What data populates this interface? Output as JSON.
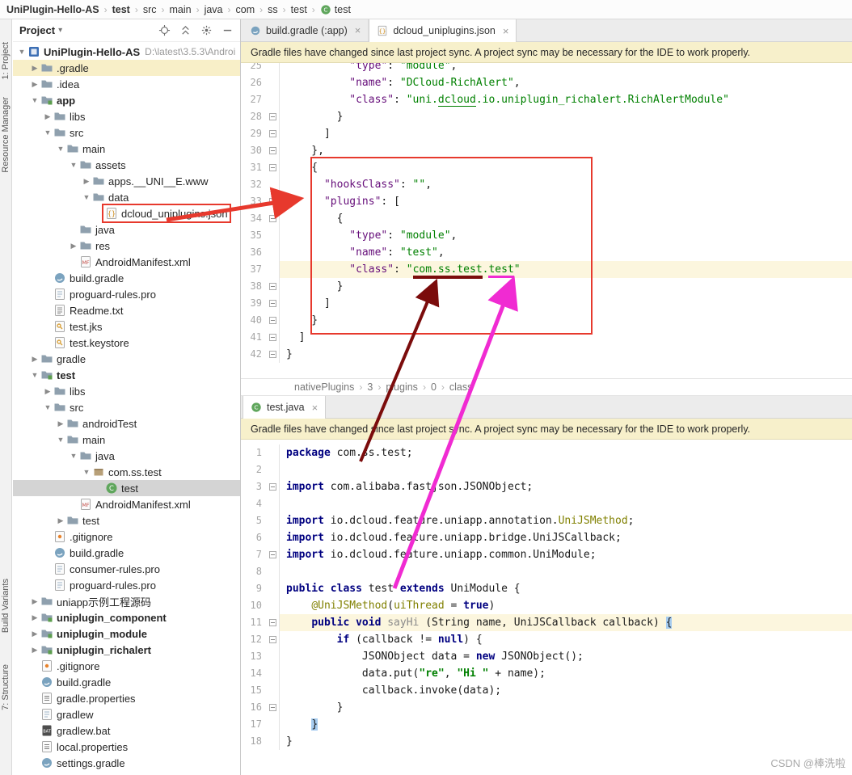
{
  "top_breadcrumb": {
    "items": [
      {
        "label": "UniPlugin-Hello-AS",
        "bold": true
      },
      {
        "label": "test",
        "bold": true
      },
      {
        "label": "src"
      },
      {
        "label": "main"
      },
      {
        "label": "java"
      },
      {
        "label": "com"
      },
      {
        "label": "ss"
      },
      {
        "label": "test"
      },
      {
        "label": "test",
        "icon": "class-icon"
      }
    ]
  },
  "tool_strip": {
    "top": [
      "1: Project",
      "Resource Manager"
    ],
    "bottom": [
      "Build Variants",
      "7: Structure"
    ]
  },
  "project_panel": {
    "title": "Project",
    "tree": [
      {
        "label": "UniPlugin-Hello-AS",
        "suffix": "D:\\latest\\3.5.3\\Androi",
        "level": 0,
        "arrow": "exp",
        "icon": "project-icon",
        "bold": true
      },
      {
        "label": ".gradle",
        "level": 1,
        "arrow": "col",
        "icon": "folder-icon",
        "row": "highlight"
      },
      {
        "label": ".idea",
        "level": 1,
        "arrow": "col",
        "icon": "folder-icon"
      },
      {
        "label": "app",
        "level": 1,
        "arrow": "exp",
        "icon": "module-icon",
        "bold": true
      },
      {
        "label": "libs",
        "level": 2,
        "arrow": "col",
        "icon": "folder-icon"
      },
      {
        "label": "src",
        "level": 2,
        "arrow": "exp",
        "icon": "folder-icon"
      },
      {
        "label": "main",
        "level": 3,
        "arrow": "exp",
        "icon": "folder-icon"
      },
      {
        "label": "assets",
        "level": 4,
        "arrow": "exp",
        "icon": "folder-icon"
      },
      {
        "label": "apps.__UNI__E.www",
        "level": 5,
        "arrow": "col",
        "icon": "folder-icon"
      },
      {
        "label": "data",
        "level": 5,
        "arrow": "exp",
        "icon": "folder-icon"
      },
      {
        "label": "dcloud_uniplugins.json",
        "level": 6,
        "arrow": "none",
        "icon": "json-icon",
        "boxed": true
      },
      {
        "label": "java",
        "level": 4,
        "arrow": "none",
        "icon": "folder-icon"
      },
      {
        "label": "res",
        "level": 4,
        "arrow": "col",
        "icon": "folder-icon"
      },
      {
        "label": "AndroidManifest.xml",
        "level": 4,
        "arrow": "none",
        "icon": "manifest-icon"
      },
      {
        "label": "build.gradle",
        "level": 2,
        "arrow": "none",
        "icon": "gradle-icon"
      },
      {
        "label": "proguard-rules.pro",
        "level": 2,
        "arrow": "none",
        "icon": "file-icon"
      },
      {
        "label": "Readme.txt",
        "level": 2,
        "arrow": "none",
        "icon": "text-icon"
      },
      {
        "label": "test.jks",
        "level": 2,
        "arrow": "none",
        "icon": "key-icon"
      },
      {
        "label": "test.keystore",
        "level": 2,
        "arrow": "none",
        "icon": "key-icon"
      },
      {
        "label": "gradle",
        "level": 1,
        "arrow": "col",
        "icon": "folder-icon"
      },
      {
        "label": "test",
        "level": 1,
        "arrow": "exp",
        "icon": "module-icon",
        "bold": true
      },
      {
        "label": "libs",
        "level": 2,
        "arrow": "col",
        "icon": "folder-icon"
      },
      {
        "label": "src",
        "level": 2,
        "arrow": "exp",
        "icon": "folder-icon"
      },
      {
        "label": "androidTest",
        "level": 3,
        "arrow": "col",
        "icon": "folder-icon"
      },
      {
        "label": "main",
        "level": 3,
        "arrow": "exp",
        "icon": "folder-icon"
      },
      {
        "label": "java",
        "level": 4,
        "arrow": "exp",
        "icon": "folder-icon"
      },
      {
        "label": "com.ss.test",
        "level": 5,
        "arrow": "exp",
        "icon": "package-icon"
      },
      {
        "label": "test",
        "level": 6,
        "arrow": "none",
        "icon": "class-icon",
        "row": "selected"
      },
      {
        "label": "AndroidManifest.xml",
        "level": 4,
        "arrow": "none",
        "icon": "manifest-icon"
      },
      {
        "label": "test",
        "level": 3,
        "arrow": "col",
        "icon": "folder-icon"
      },
      {
        "label": ".gitignore",
        "level": 2,
        "arrow": "none",
        "icon": "git-icon"
      },
      {
        "label": "build.gradle",
        "level": 2,
        "arrow": "none",
        "icon": "gradle-icon"
      },
      {
        "label": "consumer-rules.pro",
        "level": 2,
        "arrow": "none",
        "icon": "file-icon"
      },
      {
        "label": "proguard-rules.pro",
        "level": 2,
        "arrow": "none",
        "icon": "file-icon"
      },
      {
        "label": "uniapp示例工程源码",
        "level": 1,
        "arrow": "col",
        "icon": "folder-icon"
      },
      {
        "label": "uniplugin_component",
        "level": 1,
        "arrow": "col",
        "icon": "module-icon",
        "bold": true
      },
      {
        "label": "uniplugin_module",
        "level": 1,
        "arrow": "col",
        "icon": "module-icon",
        "bold": true
      },
      {
        "label": "uniplugin_richalert",
        "level": 1,
        "arrow": "col",
        "icon": "module-icon",
        "bold": true
      },
      {
        "label": ".gitignore",
        "level": 1,
        "arrow": "none",
        "icon": "git-icon"
      },
      {
        "label": "build.gradle",
        "level": 1,
        "arrow": "none",
        "icon": "gradle-icon"
      },
      {
        "label": "gradle.properties",
        "level": 1,
        "arrow": "none",
        "icon": "props-icon"
      },
      {
        "label": "gradlew",
        "level": 1,
        "arrow": "none",
        "icon": "file-icon"
      },
      {
        "label": "gradlew.bat",
        "level": 1,
        "arrow": "none",
        "icon": "bat-icon"
      },
      {
        "label": "local.properties",
        "level": 1,
        "arrow": "none",
        "icon": "props-icon"
      },
      {
        "label": "settings.gradle",
        "level": 1,
        "arrow": "none",
        "icon": "gradle-icon"
      }
    ]
  },
  "editor_top": {
    "tabs": [
      {
        "label": "build.gradle (:app)",
        "icon": "gradle-icon",
        "active": false
      },
      {
        "label": "dcloud_uniplugins.json",
        "icon": "json-icon",
        "active": true
      }
    ],
    "banner": "Gradle files have changed since last project sync. A project sync may be necessary for the IDE to work properly.",
    "language": "json",
    "lines": [
      {
        "n": 25,
        "seg": [
          [
            "t",
            "          "
          ],
          [
            "k",
            "\"type\""
          ],
          [
            "t",
            ": "
          ],
          [
            "s",
            "\"module\""
          ],
          [
            "t",
            ","
          ]
        ]
      },
      {
        "n": 26,
        "seg": [
          [
            "t",
            "          "
          ],
          [
            "k",
            "\"name\""
          ],
          [
            "t",
            ": "
          ],
          [
            "s",
            "\"DCloud-RichAlert\""
          ],
          [
            "t",
            ","
          ]
        ]
      },
      {
        "n": 27,
        "seg": [
          [
            "t",
            "          "
          ],
          [
            "k",
            "\"class\""
          ],
          [
            "t",
            ": "
          ],
          [
            "s",
            "\"uni."
          ],
          [
            "su",
            "dcloud"
          ],
          [
            "s",
            ".io.uniplugin_richalert.RichAlertModule\""
          ]
        ]
      },
      {
        "n": 28,
        "fold": true,
        "seg": [
          [
            "t",
            "        }"
          ]
        ]
      },
      {
        "n": 29,
        "fold": true,
        "seg": [
          [
            "t",
            "      ]"
          ]
        ]
      },
      {
        "n": 30,
        "fold": true,
        "seg": [
          [
            "t",
            "    },"
          ]
        ]
      },
      {
        "n": 31,
        "fold": true,
        "seg": [
          [
            "t",
            "    {"
          ]
        ]
      },
      {
        "n": 32,
        "seg": [
          [
            "t",
            "      "
          ],
          [
            "k",
            "\"hooksClass\""
          ],
          [
            "t",
            ": "
          ],
          [
            "s",
            "\"\""
          ],
          [
            "t",
            ","
          ]
        ]
      },
      {
        "n": 33,
        "fold": true,
        "seg": [
          [
            "t",
            "      "
          ],
          [
            "k",
            "\"plugins\""
          ],
          [
            "t",
            ": ["
          ]
        ]
      },
      {
        "n": 34,
        "fold": true,
        "seg": [
          [
            "t",
            "        {"
          ]
        ]
      },
      {
        "n": 35,
        "seg": [
          [
            "t",
            "          "
          ],
          [
            "k",
            "\"type\""
          ],
          [
            "t",
            ": "
          ],
          [
            "s",
            "\"module\""
          ],
          [
            "t",
            ","
          ]
        ]
      },
      {
        "n": 36,
        "seg": [
          [
            "t",
            "          "
          ],
          [
            "k",
            "\"name\""
          ],
          [
            "t",
            ": "
          ],
          [
            "s",
            "\"test\""
          ],
          [
            "t",
            ","
          ]
        ]
      },
      {
        "n": 37,
        "hl": true,
        "seg": [
          [
            "t",
            "          "
          ],
          [
            "k",
            "\"class\""
          ],
          [
            "t",
            ": "
          ],
          [
            "s",
            "\""
          ],
          [
            "sr",
            "com.ss.test"
          ],
          [
            "s",
            "."
          ],
          [
            "sm",
            "test"
          ],
          [
            "s",
            "\""
          ]
        ]
      },
      {
        "n": 38,
        "fold": true,
        "seg": [
          [
            "t",
            "        }"
          ]
        ]
      },
      {
        "n": 39,
        "fold": true,
        "seg": [
          [
            "t",
            "      ]"
          ]
        ]
      },
      {
        "n": 40,
        "fold": true,
        "seg": [
          [
            "t",
            "    }"
          ]
        ]
      },
      {
        "n": 41,
        "fold": true,
        "seg": [
          [
            "t",
            "  ]"
          ]
        ]
      },
      {
        "n": 42,
        "fold": true,
        "seg": [
          [
            "t",
            "}"
          ]
        ]
      }
    ]
  },
  "editor_breadcrumb": {
    "items": [
      "nativePlugins",
      "3",
      "plugins",
      "0",
      "class"
    ]
  },
  "editor_bottom": {
    "tabs": [
      {
        "label": "test.java",
        "icon": "class-icon",
        "active": true
      }
    ],
    "banner": "Gradle files have changed since last project sync. A project sync may be necessary for the IDE to work properly.",
    "language": "java",
    "lines": [
      {
        "n": 1,
        "seg": [
          [
            "w",
            "package"
          ],
          [
            "t",
            " com.ss.test;"
          ]
        ]
      },
      {
        "n": 2,
        "seg": []
      },
      {
        "n": 3,
        "fold": true,
        "seg": [
          [
            "w",
            "import"
          ],
          [
            "t",
            " com.alibaba.fastjson.JSONObject;"
          ]
        ]
      },
      {
        "n": 4,
        "seg": []
      },
      {
        "n": 5,
        "seg": [
          [
            "w",
            "import"
          ],
          [
            "t",
            " io.dcloud.feature.uniapp.annotation."
          ],
          [
            "a",
            "UniJSMethod"
          ],
          [
            "t",
            ";"
          ]
        ]
      },
      {
        "n": 6,
        "seg": [
          [
            "w",
            "import"
          ],
          [
            "t",
            " io.dcloud.feature.uniapp.bridge.UniJSCallback;"
          ]
        ]
      },
      {
        "n": 7,
        "fold": true,
        "seg": [
          [
            "w",
            "import"
          ],
          [
            "t",
            " io.dcloud.feature.uniapp.common.UniModule;"
          ]
        ]
      },
      {
        "n": 8,
        "seg": []
      },
      {
        "n": 9,
        "seg": [
          [
            "w",
            "public class"
          ],
          [
            "t",
            " test "
          ],
          [
            "w",
            "extends"
          ],
          [
            "t",
            " UniModule {"
          ]
        ]
      },
      {
        "n": 10,
        "seg": [
          [
            "t",
            "    "
          ],
          [
            "a",
            "@UniJSMethod"
          ],
          [
            "t",
            "("
          ],
          [
            "a",
            "uiThread"
          ],
          [
            "t",
            " = "
          ],
          [
            "w",
            "true"
          ],
          [
            "t",
            ")"
          ]
        ]
      },
      {
        "n": 11,
        "hl": true,
        "fold": true,
        "seg": [
          [
            "t",
            "    "
          ],
          [
            "w",
            "public void"
          ],
          [
            "t",
            " "
          ],
          [
            "g",
            "sayHi"
          ],
          [
            "t",
            " (String name, UniJSCallback callback) "
          ],
          [
            "b",
            "{"
          ]
        ]
      },
      {
        "n": 12,
        "fold": true,
        "seg": [
          [
            "t",
            "        "
          ],
          [
            "w",
            "if"
          ],
          [
            "t",
            " (callback != "
          ],
          [
            "w",
            "null"
          ],
          [
            "t",
            ") {"
          ]
        ]
      },
      {
        "n": 13,
        "seg": [
          [
            "t",
            "            JSONObject data = "
          ],
          [
            "w",
            "new"
          ],
          [
            "t",
            " JSONObject();"
          ]
        ]
      },
      {
        "n": 14,
        "seg": [
          [
            "t",
            "            data.put("
          ],
          [
            "s",
            "\"re\""
          ],
          [
            "t",
            ", "
          ],
          [
            "s",
            "\"Hi \""
          ],
          [
            "t",
            " + name);"
          ]
        ]
      },
      {
        "n": 15,
        "seg": [
          [
            "t",
            "            callback.invoke(data);"
          ]
        ]
      },
      {
        "n": 16,
        "fold": true,
        "seg": [
          [
            "t",
            "        }"
          ]
        ]
      },
      {
        "n": 17,
        "seg": [
          [
            "t",
            "    "
          ],
          [
            "b",
            "}"
          ]
        ]
      },
      {
        "n": 18,
        "seg": [
          [
            "t",
            "}"
          ]
        ]
      }
    ]
  },
  "colors": {
    "json_key": "#660E7A",
    "string_green": "#008000",
    "keyword_navy": "#000080",
    "annotation_olive": "#808000",
    "caret_line": "#FCF6DE",
    "brace_match": "#A6CCF0",
    "banner_bg": "#F7F0CB",
    "selection_gray": "#D4D4D4",
    "row_highlight": "#F8EFC8"
  },
  "annotations": {
    "box_color": "#E7392D",
    "arrow_red": "#E7392D",
    "arrow_maroon": "#7B0C0C",
    "arrow_magenta": "#F02BD2",
    "underline_maroon": "#7B0C0C",
    "underline_magenta": "#F02BD2"
  },
  "watermark": "CSDN @棒洗啦"
}
